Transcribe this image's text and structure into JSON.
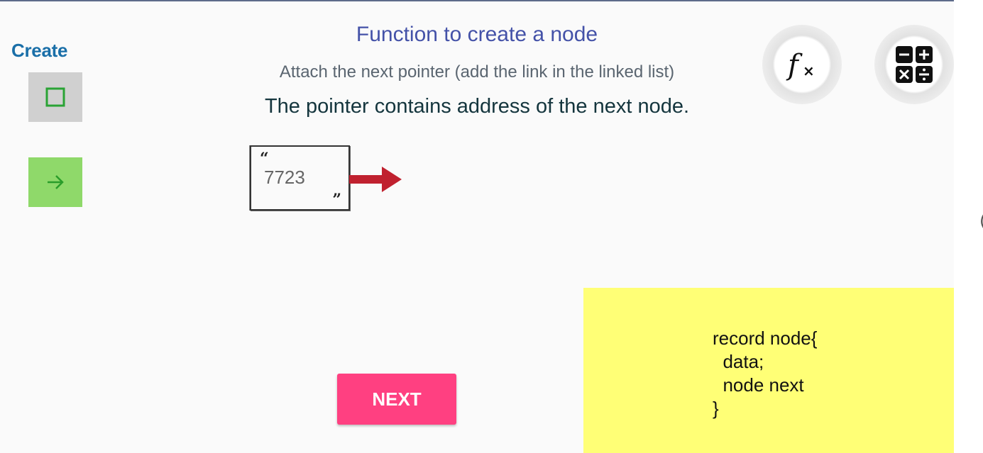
{
  "sidebar": {
    "title": "Create",
    "tools": [
      {
        "name": "node-tool",
        "icon": "square-outline-icon"
      },
      {
        "name": "pointer-tool",
        "icon": "arrow-right-icon"
      }
    ]
  },
  "header": {
    "title": "Function to create a node",
    "subtitle": "Attach the next pointer (add the link in the linked list)",
    "description": "The pointer contains address of the next node."
  },
  "fabs": [
    {
      "name": "formula",
      "icon": "function-fx-icon"
    },
    {
      "name": "calculator",
      "icon": "calculator-icon"
    }
  ],
  "diagram": {
    "open_quote": "“",
    "node_value": "7723",
    "close_quote": "”",
    "arrow_color": "#c0212f"
  },
  "next_button": {
    "label": "NEXT"
  },
  "code": {
    "lines": [
      "record node{",
      "  data;",
      "  node next",
      "}"
    ]
  },
  "colors": {
    "accent_pink": "#ff4081",
    "title_blue": "#4452a8",
    "code_panel_yellow": "#ffff76",
    "pointer_tool_green": "#8fd96a"
  }
}
